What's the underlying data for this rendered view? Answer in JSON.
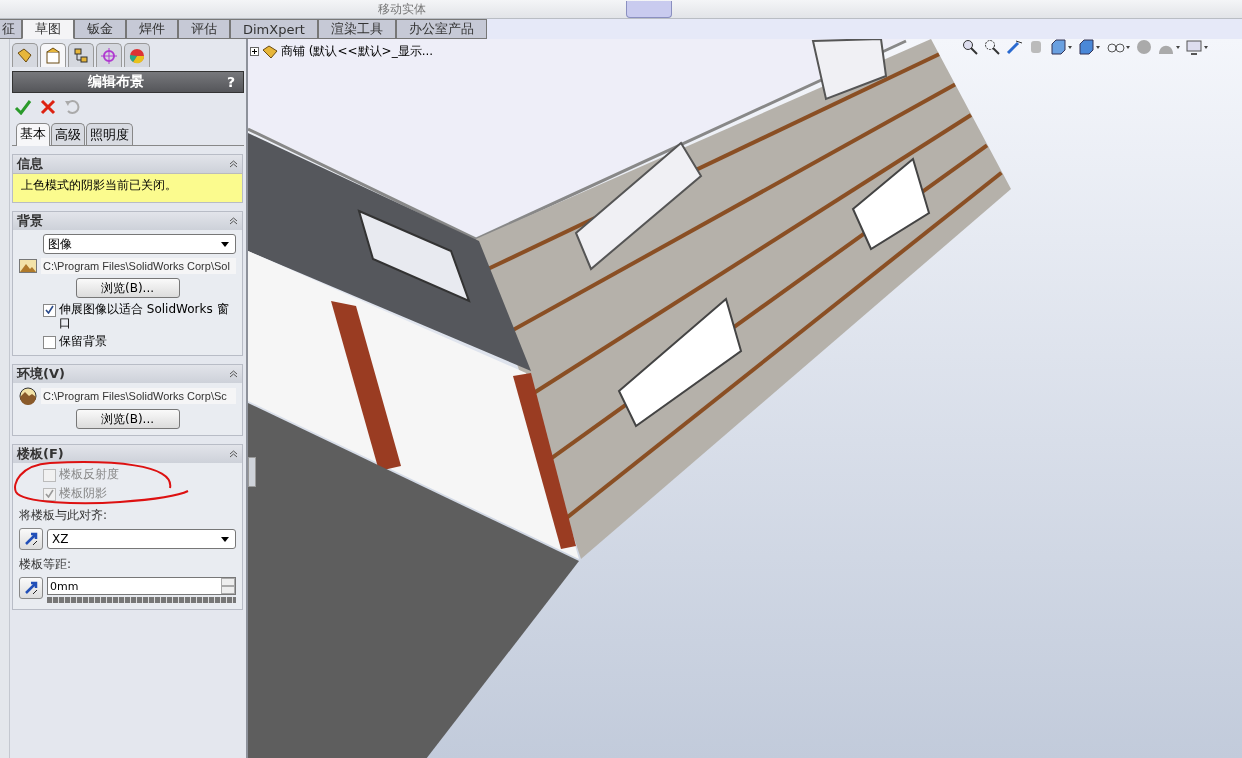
{
  "toolbar": {
    "label": "移动实体"
  },
  "command_tabs": [
    {
      "label": "征",
      "selected": false
    },
    {
      "label": "草图",
      "selected": true
    },
    {
      "label": "钣金",
      "selected": false
    },
    {
      "label": "焊件",
      "selected": false
    },
    {
      "label": "评估",
      "selected": false
    },
    {
      "label": "DimXpert",
      "selected": false
    },
    {
      "label": "渲染工具",
      "selected": false
    },
    {
      "label": "办公室产品",
      "selected": false
    }
  ],
  "manager_tabs": [
    {
      "kind": "feature",
      "selected": false
    },
    {
      "kind": "property",
      "selected": true
    },
    {
      "kind": "config",
      "selected": false
    },
    {
      "kind": "dim",
      "selected": false
    },
    {
      "kind": "display",
      "selected": false
    }
  ],
  "property_manager": {
    "title": "编辑布景",
    "help": "?",
    "tabs": [
      {
        "label": "基本",
        "selected": true
      },
      {
        "label": "高级",
        "selected": false
      },
      {
        "label": "照明度",
        "selected": false
      }
    ],
    "info": {
      "title": "信息",
      "text": "上色模式的阴影当前已关闭。"
    },
    "background": {
      "title": "背景",
      "dropdown": "图像",
      "path": "C:\\Program Files\\SolidWorks Corp\\Sol",
      "browse": "浏览(B)...",
      "options": [
        {
          "label": "伸展图像以适合 SolidWorks 窗口",
          "checked": true,
          "disabled": false
        },
        {
          "label": "保留背景",
          "checked": false,
          "disabled": false
        }
      ]
    },
    "environment": {
      "title": "环境(V)",
      "path": "C:\\Program Files\\SolidWorks Corp\\Sc",
      "browse": "浏览(B)..."
    },
    "floor": {
      "title": "楼板(F)",
      "options": [
        {
          "label": "楼板反射度",
          "checked": false,
          "disabled": true
        },
        {
          "label": "楼板阴影",
          "checked": true,
          "disabled": true
        }
      ],
      "align_label": "将楼板与此对齐:",
      "align_value": "XZ",
      "offset_label": "楼板等距:",
      "offset_value": "0mm"
    }
  },
  "tree": {
    "label": "商铺  (默认<<默认>_显示..."
  }
}
